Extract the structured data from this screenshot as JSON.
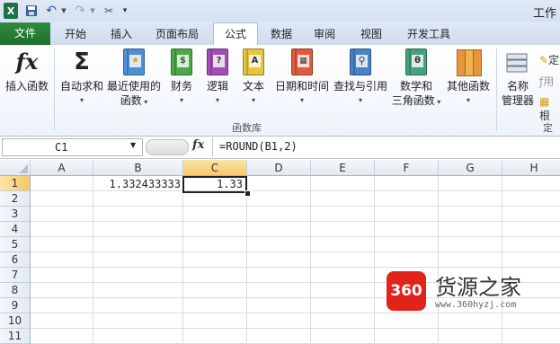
{
  "window": {
    "title": "工作"
  },
  "quick_access": {
    "save_icon": "save-icon",
    "undo_icon": "undo-icon",
    "redo_icon": "redo-icon",
    "customize_icon": "customize-qat-icon"
  },
  "tabs": [
    {
      "label": "文件"
    },
    {
      "label": "开始"
    },
    {
      "label": "插入"
    },
    {
      "label": "页面布局"
    },
    {
      "label": "公式"
    },
    {
      "label": "数据"
    },
    {
      "label": "审阅"
    },
    {
      "label": "视图"
    },
    {
      "label": "开发工具"
    }
  ],
  "ribbon": {
    "insert_function": {
      "label": "插入函数",
      "icon_text": "fx"
    },
    "autosum": {
      "label": "自动求和",
      "icon_text": "Σ"
    },
    "recent": {
      "line1": "最近使用的",
      "line2": "函数"
    },
    "financial": {
      "label": "财务"
    },
    "logical": {
      "label": "逻辑",
      "icon_text": "?"
    },
    "text": {
      "label": "文本",
      "icon_text": "A"
    },
    "datetime": {
      "label": "日期和时间"
    },
    "lookup": {
      "label": "查找与引用"
    },
    "math": {
      "line1": "数学和",
      "line2": "三角函数",
      "icon_text": "θ"
    },
    "more": {
      "label": "其他函数"
    },
    "name_manager": {
      "line1": "名称",
      "line2": "管理器"
    },
    "group_label": "函数库",
    "right_cut_label": "定义",
    "right_cut_1": "定",
    "right_cut_2": "用",
    "right_cut_3": "根"
  },
  "formula_bar": {
    "name_box": "C1",
    "fx_label": "fx",
    "formula": "=ROUND(B1,2)"
  },
  "sheet": {
    "columns": [
      "A",
      "B",
      "C",
      "D",
      "E",
      "F",
      "G",
      "H"
    ],
    "rows": [
      "1",
      "2",
      "3",
      "4",
      "5",
      "6",
      "7",
      "8",
      "9",
      "10",
      "11"
    ],
    "active_cell": "C1",
    "cells": {
      "B1": "1.332433333",
      "C1": "1.33"
    }
  },
  "watermark": {
    "badge": "360",
    "name": "货源之家",
    "url": "www.360hyzj.com"
  },
  "colors": {
    "file_tab": "#1e6f2c",
    "ribbon_bg": "#eef3fa",
    "active_header": "#f6c76a",
    "grid_line": "#dadcdd",
    "watermark_red": "#e2231a"
  }
}
